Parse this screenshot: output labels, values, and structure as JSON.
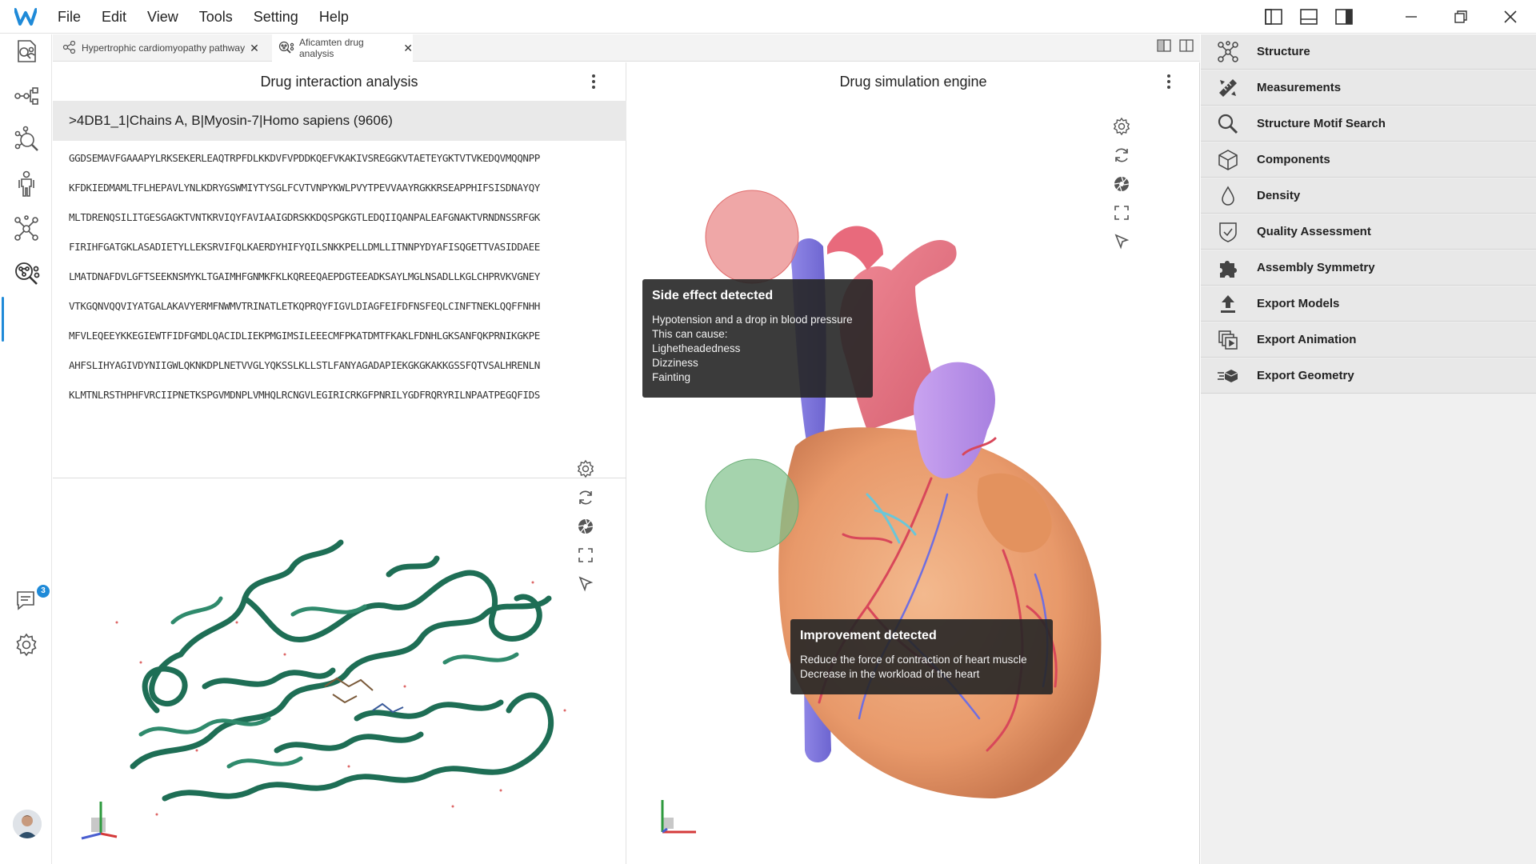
{
  "app": {
    "logo_letter": "W",
    "accent_color": "#1f8ad8"
  },
  "menu": {
    "items": [
      "File",
      "Edit",
      "View",
      "Tools",
      "Setting",
      "Help"
    ]
  },
  "tabs": [
    {
      "label": "Hypertrophic cardiomyopathy pathway",
      "icon": "pathway-icon",
      "active": false
    },
    {
      "label": "Aficamten drug analysis",
      "icon": "drug-analysis-icon",
      "active": true
    }
  ],
  "rail": {
    "items": [
      "search-profile-icon",
      "workflow-icon",
      "molecule-search-icon",
      "human-body-icon",
      "network-icon",
      "drug-analysis-icon"
    ],
    "active_item": "drug-analysis-icon",
    "chat_badge": "3"
  },
  "left_panel": {
    "title": "Drug interaction analysis",
    "sequence_header": ">4DB1_1|Chains A, B|Myosin-7|Homo sapiens (9606)",
    "sequence_lines": [
      "GGDSEMAVFGAAAPYLRKSEKERLEAQTRPFDLKKDVFVPDDKQEFVKAKIVSREGGKVTAETEYGKTVTVKEDQVMQQNPP",
      "KFDKIEDMAMLTFLHEPAVLYNLKDRYGSWMIYTYSGLFCVTVNPYKWLPVYTPEVVAAYRGKKRSEAPPHIFSISDNAYQY",
      "MLTDRENQSILITGESGAGKTVNTKRVIQYFAVIAAIGDRSKKDQSPGKGTLEDQIIQANPALEAFGNAKTVRNDNSSRFGK",
      "FIRIHFGATGKLASADIETYLLEKSRVIFQLKAERDYHIFYQILSNKKPELLDMLLITNNPYDYAFISQGETTVASIDDAEE",
      "LMATDNAFDVLGFTSEEKNSMYKLTGAIMHFGNMKFKLKQREEQAEPDGTEEADKSAYLMGLNSADLLKGLCHPRVKVGNEY",
      "VTKGQNVQQVIYATGALAKAVYERMFNWMVTRINATLETKQPRQYFIGVLDIAGFEIFDFNSFEQLCINFTNEKLQQFFNHH",
      "MFVLEQEEYKKEGIEWTFIDFGMDLQACIDLIEKPMGIMSILEEECMFPKATDMTFKAKLFDNHLGKSANFQKPRNIKGKPE",
      "AHFSLIHYAGIVDYNIIGWLQKNKDPLNETVVGLYQKSSLKLLSTLFANYAGADAPIEKGKGKAKKGSSFQTVSALHRENLN",
      "KLMTNLRSTHPHFVRCIIPNETKSPGVMDNPLVMHQLRCNGVLEGIRICRKGFPNRILYGDFRQRYRILNPAATPEGQFIDS"
    ],
    "viewer_tools": [
      "gear-icon",
      "rotate-icon",
      "aperture-icon",
      "fullscreen-icon",
      "pointer-icon"
    ],
    "protein_color": "#1e6e55"
  },
  "center_panel": {
    "title": "Drug simulation engine",
    "viewer_tools": [
      "gear-icon",
      "rotate-icon",
      "aperture-icon",
      "fullscreen-icon",
      "pointer-icon"
    ],
    "side_effect": {
      "title": "Side effect detected",
      "lines": [
        "Hypotension and a drop in blood pressure",
        "This can cause:",
        "Lighetheadedness",
        "Dizziness",
        "Fainting"
      ],
      "highlight_color": "#e98a8a"
    },
    "improvement": {
      "title": "Improvement detected",
      "lines": [
        "Reduce the force of contraction of heart muscle",
        "Decrease in the workload of the heart"
      ],
      "highlight_color": "#7fc08a"
    }
  },
  "right_panel": {
    "items": [
      {
        "label": "Structure",
        "icon": "structure-icon"
      },
      {
        "label": "Measurements",
        "icon": "measurements-icon"
      },
      {
        "label": "Structure Motif Search",
        "icon": "search-icon"
      },
      {
        "label": "Components",
        "icon": "cube-icon"
      },
      {
        "label": "Density",
        "icon": "droplet-icon"
      },
      {
        "label": "Quality Assessment",
        "icon": "shield-check-icon"
      },
      {
        "label": "Assembly Symmetry",
        "icon": "puzzle-icon"
      },
      {
        "label": "Export Models",
        "icon": "upload-icon"
      },
      {
        "label": "Export Animation",
        "icon": "animation-icon"
      },
      {
        "label": "Export Geometry",
        "icon": "geometry-icon"
      }
    ]
  }
}
